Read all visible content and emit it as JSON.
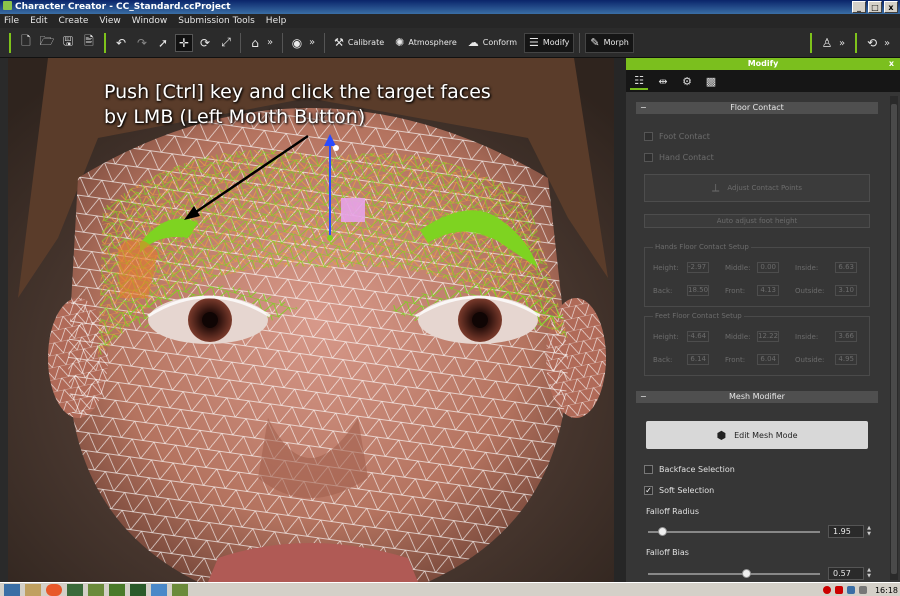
{
  "window": {
    "title": "Character Creator - CC_Standard.ccProject",
    "controls": [
      "_",
      "□",
      "x"
    ]
  },
  "menu": [
    "File",
    "Edit",
    "Create",
    "View",
    "Window",
    "Submission Tools",
    "Help"
  ],
  "toolbar": {
    "calibrate": "Calibrate",
    "atmosphere": "Atmosphere",
    "conform": "Conform",
    "modify": "Modify",
    "morph": "Morph",
    "more": "»"
  },
  "viewport": {
    "annotation_line1": "Push [Ctrl] key and click the target faces",
    "annotation_line2": "by LMB (Left Mouth Button)"
  },
  "panel": {
    "title": "Modify",
    "close": "x",
    "floor_contact": {
      "header": "Floor Contact",
      "foot_contact": "Foot Contact",
      "hand_contact": "Hand Contact",
      "adjust_contact_points": "Adjust Contact Points",
      "auto_adjust_foot_height": "Auto adjust foot height",
      "hands_setup": {
        "title": "Hands Floor Contact Setup",
        "height_label": "Height:",
        "height": "-2.97",
        "middle_label": "Middle:",
        "middle": "0.00",
        "inside_label": "Inside:",
        "inside": "6.63",
        "back_label": "Back:",
        "back": "18.50",
        "front_label": "Front:",
        "front": "4.13",
        "outside_label": "Outside:",
        "outside": "3.10"
      },
      "feet_setup": {
        "title": "Feet Floor Contact Setup",
        "height_label": "Height:",
        "height": "-4.64",
        "middle_label": "Middle:",
        "middle": "12.22",
        "inside_label": "Inside:",
        "inside": "3.66",
        "back_label": "Back:",
        "back": "6.14",
        "front_label": "Front:",
        "front": "6.04",
        "outside_label": "Outside:",
        "outside": "4.95"
      }
    },
    "mesh_modifier": {
      "header": "Mesh Modifier",
      "edit_mesh_mode": "Edit Mesh Mode",
      "backface_selection": "Backface Selection",
      "backface_checked": false,
      "soft_selection": "Soft Selection",
      "soft_checked": true,
      "falloff_radius_label": "Falloff Radius",
      "falloff_radius": "1.95",
      "falloff_radius_fraction": 0.08,
      "falloff_bias_label": "Falloff Bias",
      "falloff_bias": "0.57",
      "falloff_bias_fraction": 0.57
    }
  },
  "taskbar": {
    "clock": "16:18"
  },
  "colors": {
    "accent": "#7bbf1e",
    "selection_green": "#7ed321",
    "wire": "#ffffff"
  }
}
